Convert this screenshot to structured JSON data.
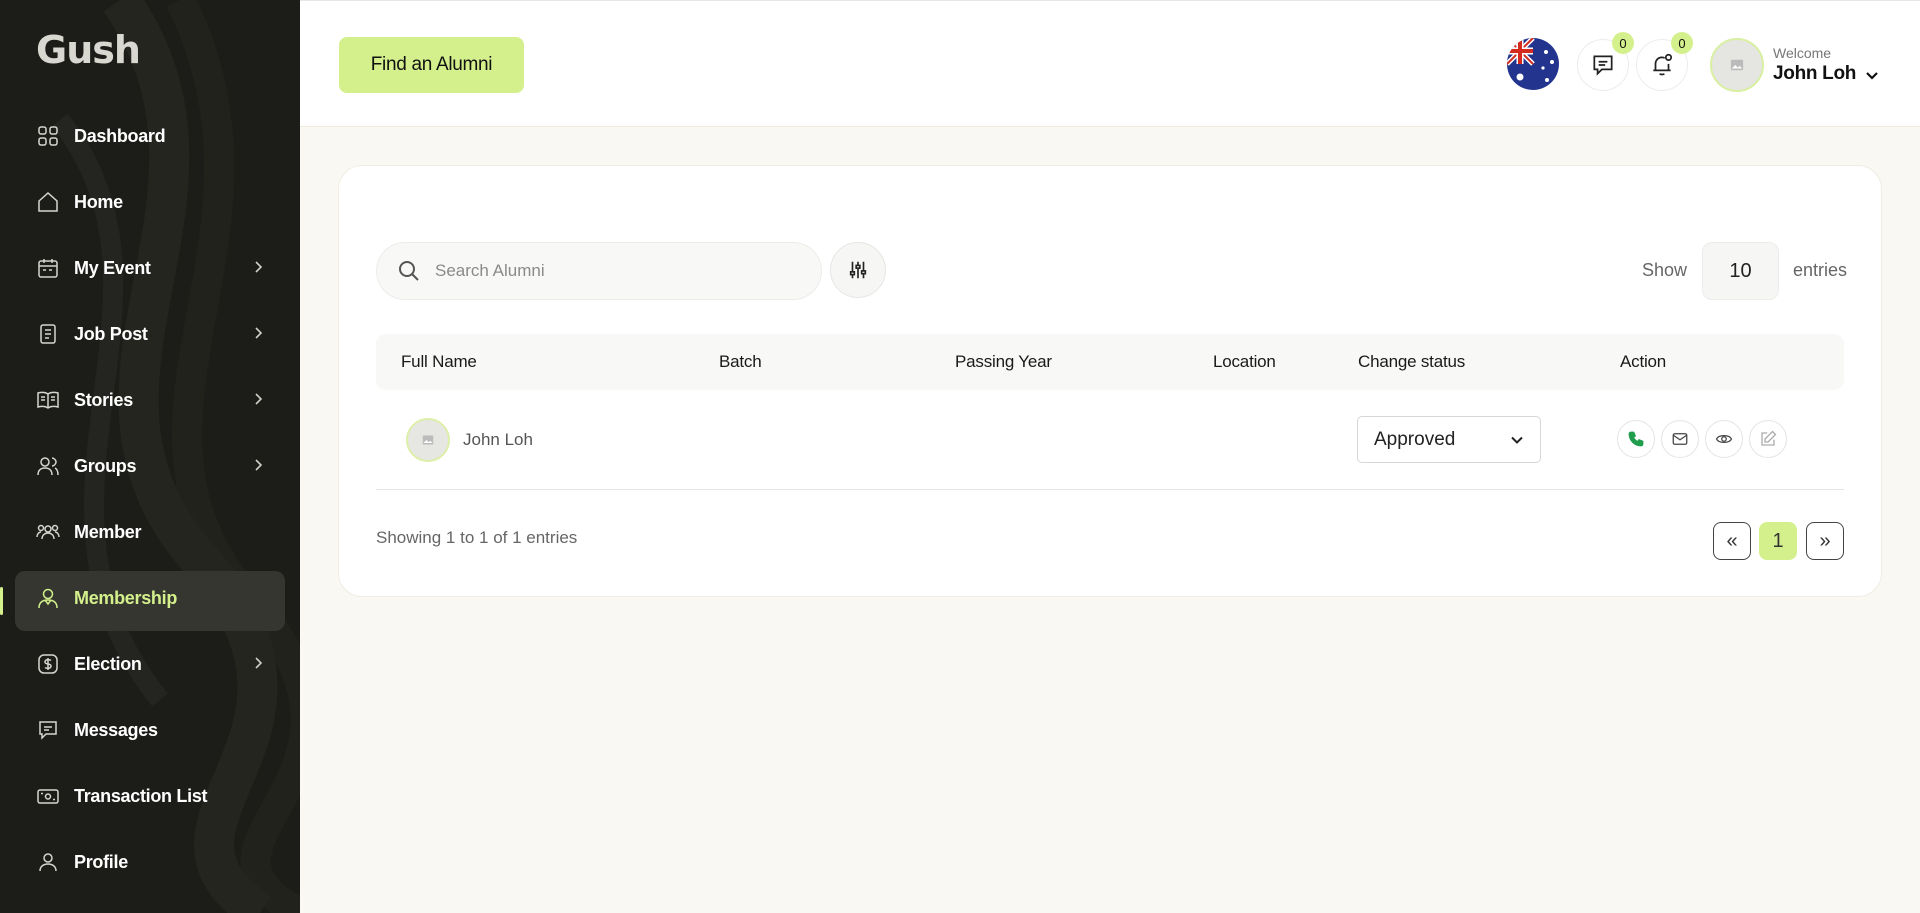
{
  "brand": {
    "logo": "Gush"
  },
  "sidebar": {
    "items": [
      {
        "label": "Dashboard",
        "icon": "dashboard-grid-icon",
        "has_submenu": false,
        "active": false
      },
      {
        "label": "Home",
        "icon": "home-icon",
        "has_submenu": false,
        "active": false
      },
      {
        "label": "My Event",
        "icon": "calendar-icon",
        "has_submenu": true,
        "active": false
      },
      {
        "label": "Job Post",
        "icon": "document-icon",
        "has_submenu": true,
        "active": false
      },
      {
        "label": "Stories",
        "icon": "book-icon",
        "has_submenu": true,
        "active": false
      },
      {
        "label": "Groups",
        "icon": "users-icon",
        "has_submenu": true,
        "active": false
      },
      {
        "label": "Member",
        "icon": "members-icon",
        "has_submenu": false,
        "active": false
      },
      {
        "label": "Membership",
        "icon": "membership-icon",
        "has_submenu": false,
        "active": true
      },
      {
        "label": "Election",
        "icon": "dollar-icon",
        "has_submenu": true,
        "active": false
      },
      {
        "label": "Messages",
        "icon": "message-icon",
        "has_submenu": false,
        "active": false
      },
      {
        "label": "Transaction List",
        "icon": "money-icon",
        "has_submenu": false,
        "active": false
      },
      {
        "label": "Profile",
        "icon": "user-icon",
        "has_submenu": false,
        "active": false
      }
    ]
  },
  "header": {
    "find_button": "Find an Alumni",
    "flag": "australia-flag-icon",
    "messages_count": "0",
    "notifications_count": "0",
    "welcome": "Welcome",
    "user_name": "John Loh"
  },
  "toolbar": {
    "search_placeholder": "Search Alumni",
    "show_label": "Show",
    "entries_value": "10",
    "entries_label": "entries"
  },
  "table": {
    "columns": [
      "Full Name",
      "Batch",
      "Passing Year",
      "Location",
      "Change status",
      "Action"
    ],
    "rows": [
      {
        "full_name": "John Loh",
        "batch": "",
        "passing_year": "",
        "location": "",
        "status": "Approved"
      }
    ]
  },
  "footer": {
    "showing_text": "Showing 1 to 1 of 1 entries",
    "prev": "«",
    "current_page": "1",
    "next": "»"
  },
  "colors": {
    "accent": "#d4f08c",
    "sidebar_bg": "#1c1d18",
    "page_bg": "#faf8f2"
  }
}
